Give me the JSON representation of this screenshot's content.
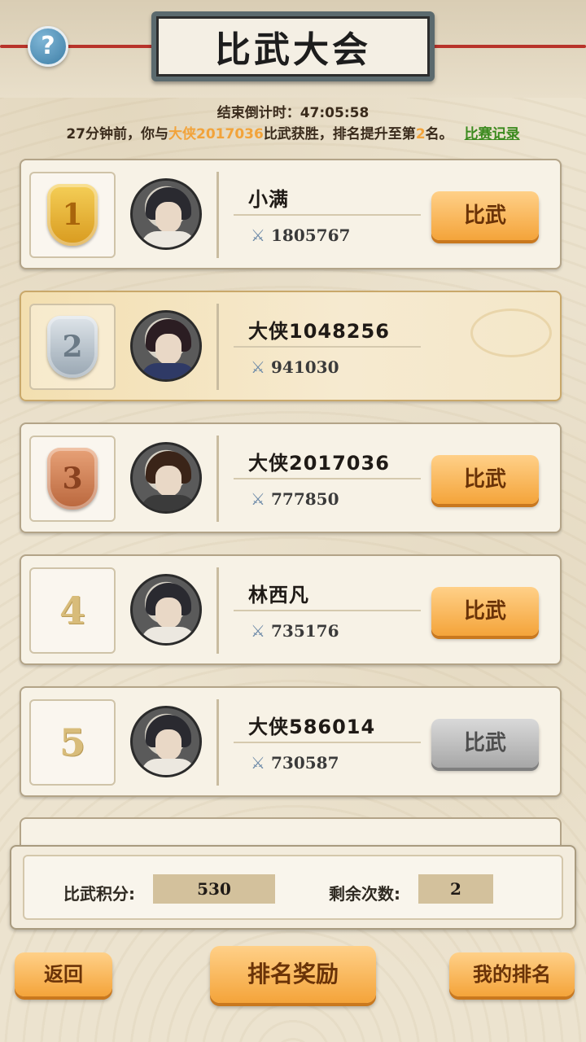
{
  "header": {
    "title": "比武大会",
    "help_label": "?"
  },
  "countdown": {
    "label": "结束倒计时：",
    "time": "47:05:58"
  },
  "news": {
    "prefix": "27分钟前，你与",
    "opponent": "大侠2017036",
    "middle": "比武获胜，排名提升至第",
    "rank": "2",
    "suffix": "名。",
    "link_label": "比赛记录"
  },
  "rankings": [
    {
      "rank": "1",
      "badge": "gold",
      "name": "小满",
      "power": "1805767",
      "button": "比武",
      "button_state": "active"
    },
    {
      "rank": "2",
      "badge": "silver",
      "name": "大侠1048256",
      "power": "941030",
      "button": "",
      "button_state": "self"
    },
    {
      "rank": "3",
      "badge": "bronze",
      "name": "大侠2017036",
      "power": "777850",
      "button": "比武",
      "button_state": "active"
    },
    {
      "rank": "4",
      "badge": "plain",
      "name": "林西凡",
      "power": "735176",
      "button": "比武",
      "button_state": "active"
    },
    {
      "rank": "5",
      "badge": "plain",
      "name": "大侠586014",
      "power": "730587",
      "button": "比武",
      "button_state": "disabled"
    }
  ],
  "score": {
    "points_label": "比武积分:",
    "points_value": "530",
    "remaining_label": "剩余次数:",
    "remaining_value": "2"
  },
  "footer": {
    "back_label": "返回",
    "rewards_label": "排名奖励",
    "my_rank_label": "我的排名"
  },
  "colors": {
    "accent_orange": "#f4a43a",
    "highlight_text": "#f2a33a",
    "link_green": "#3b8a1e",
    "rope_red": "#b8332a"
  }
}
